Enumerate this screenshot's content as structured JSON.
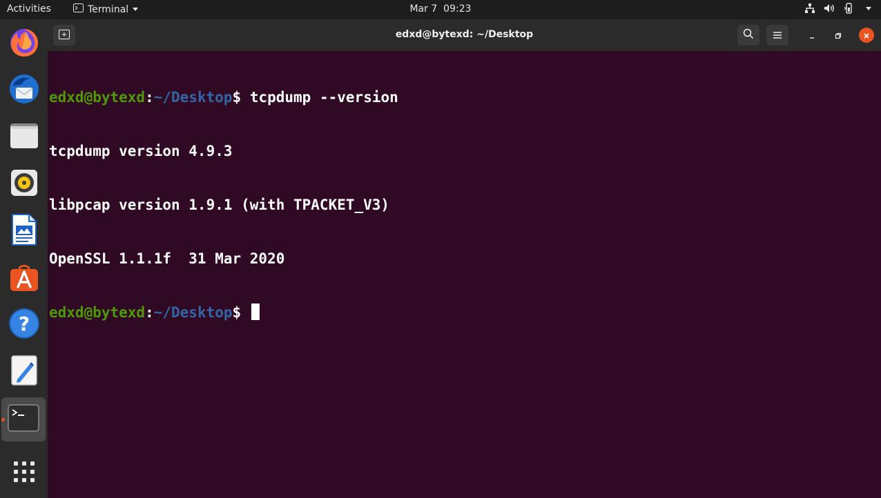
{
  "topbar": {
    "activities": "Activities",
    "app_name": "Terminal",
    "date": "Mar 7",
    "time": "09:23"
  },
  "dock": {
    "items": [
      {
        "name": "firefox-icon"
      },
      {
        "name": "thunderbird-icon"
      },
      {
        "name": "files-icon"
      },
      {
        "name": "rhythmbox-icon"
      },
      {
        "name": "libreoffice-writer-icon"
      },
      {
        "name": "software-center-icon"
      },
      {
        "name": "help-icon"
      },
      {
        "name": "text-editor-icon"
      },
      {
        "name": "terminal-icon",
        "active": true
      },
      {
        "name": "show-apps-icon"
      }
    ]
  },
  "window": {
    "title": "edxd@bytexd: ~/Desktop"
  },
  "terminal": {
    "lines": [
      {
        "user": "edxd@bytexd",
        "sep": ":",
        "path": "~/Desktop",
        "prompt": "$ ",
        "cmd": "tcpdump --version"
      },
      {
        "text": "tcpdump version 4.9.3"
      },
      {
        "text": "libpcap version 1.9.1 (with TPACKET_V3)"
      },
      {
        "text": "OpenSSL 1.1.1f  31 Mar 2020"
      },
      {
        "user": "edxd@bytexd",
        "sep": ":",
        "path": "~/Desktop",
        "prompt": "$ ",
        "cmd": ""
      }
    ]
  },
  "colors": {
    "terminal_bg": "#300a24",
    "user": "#4e9a06",
    "path": "#3465a4",
    "accent": "#e95420"
  }
}
